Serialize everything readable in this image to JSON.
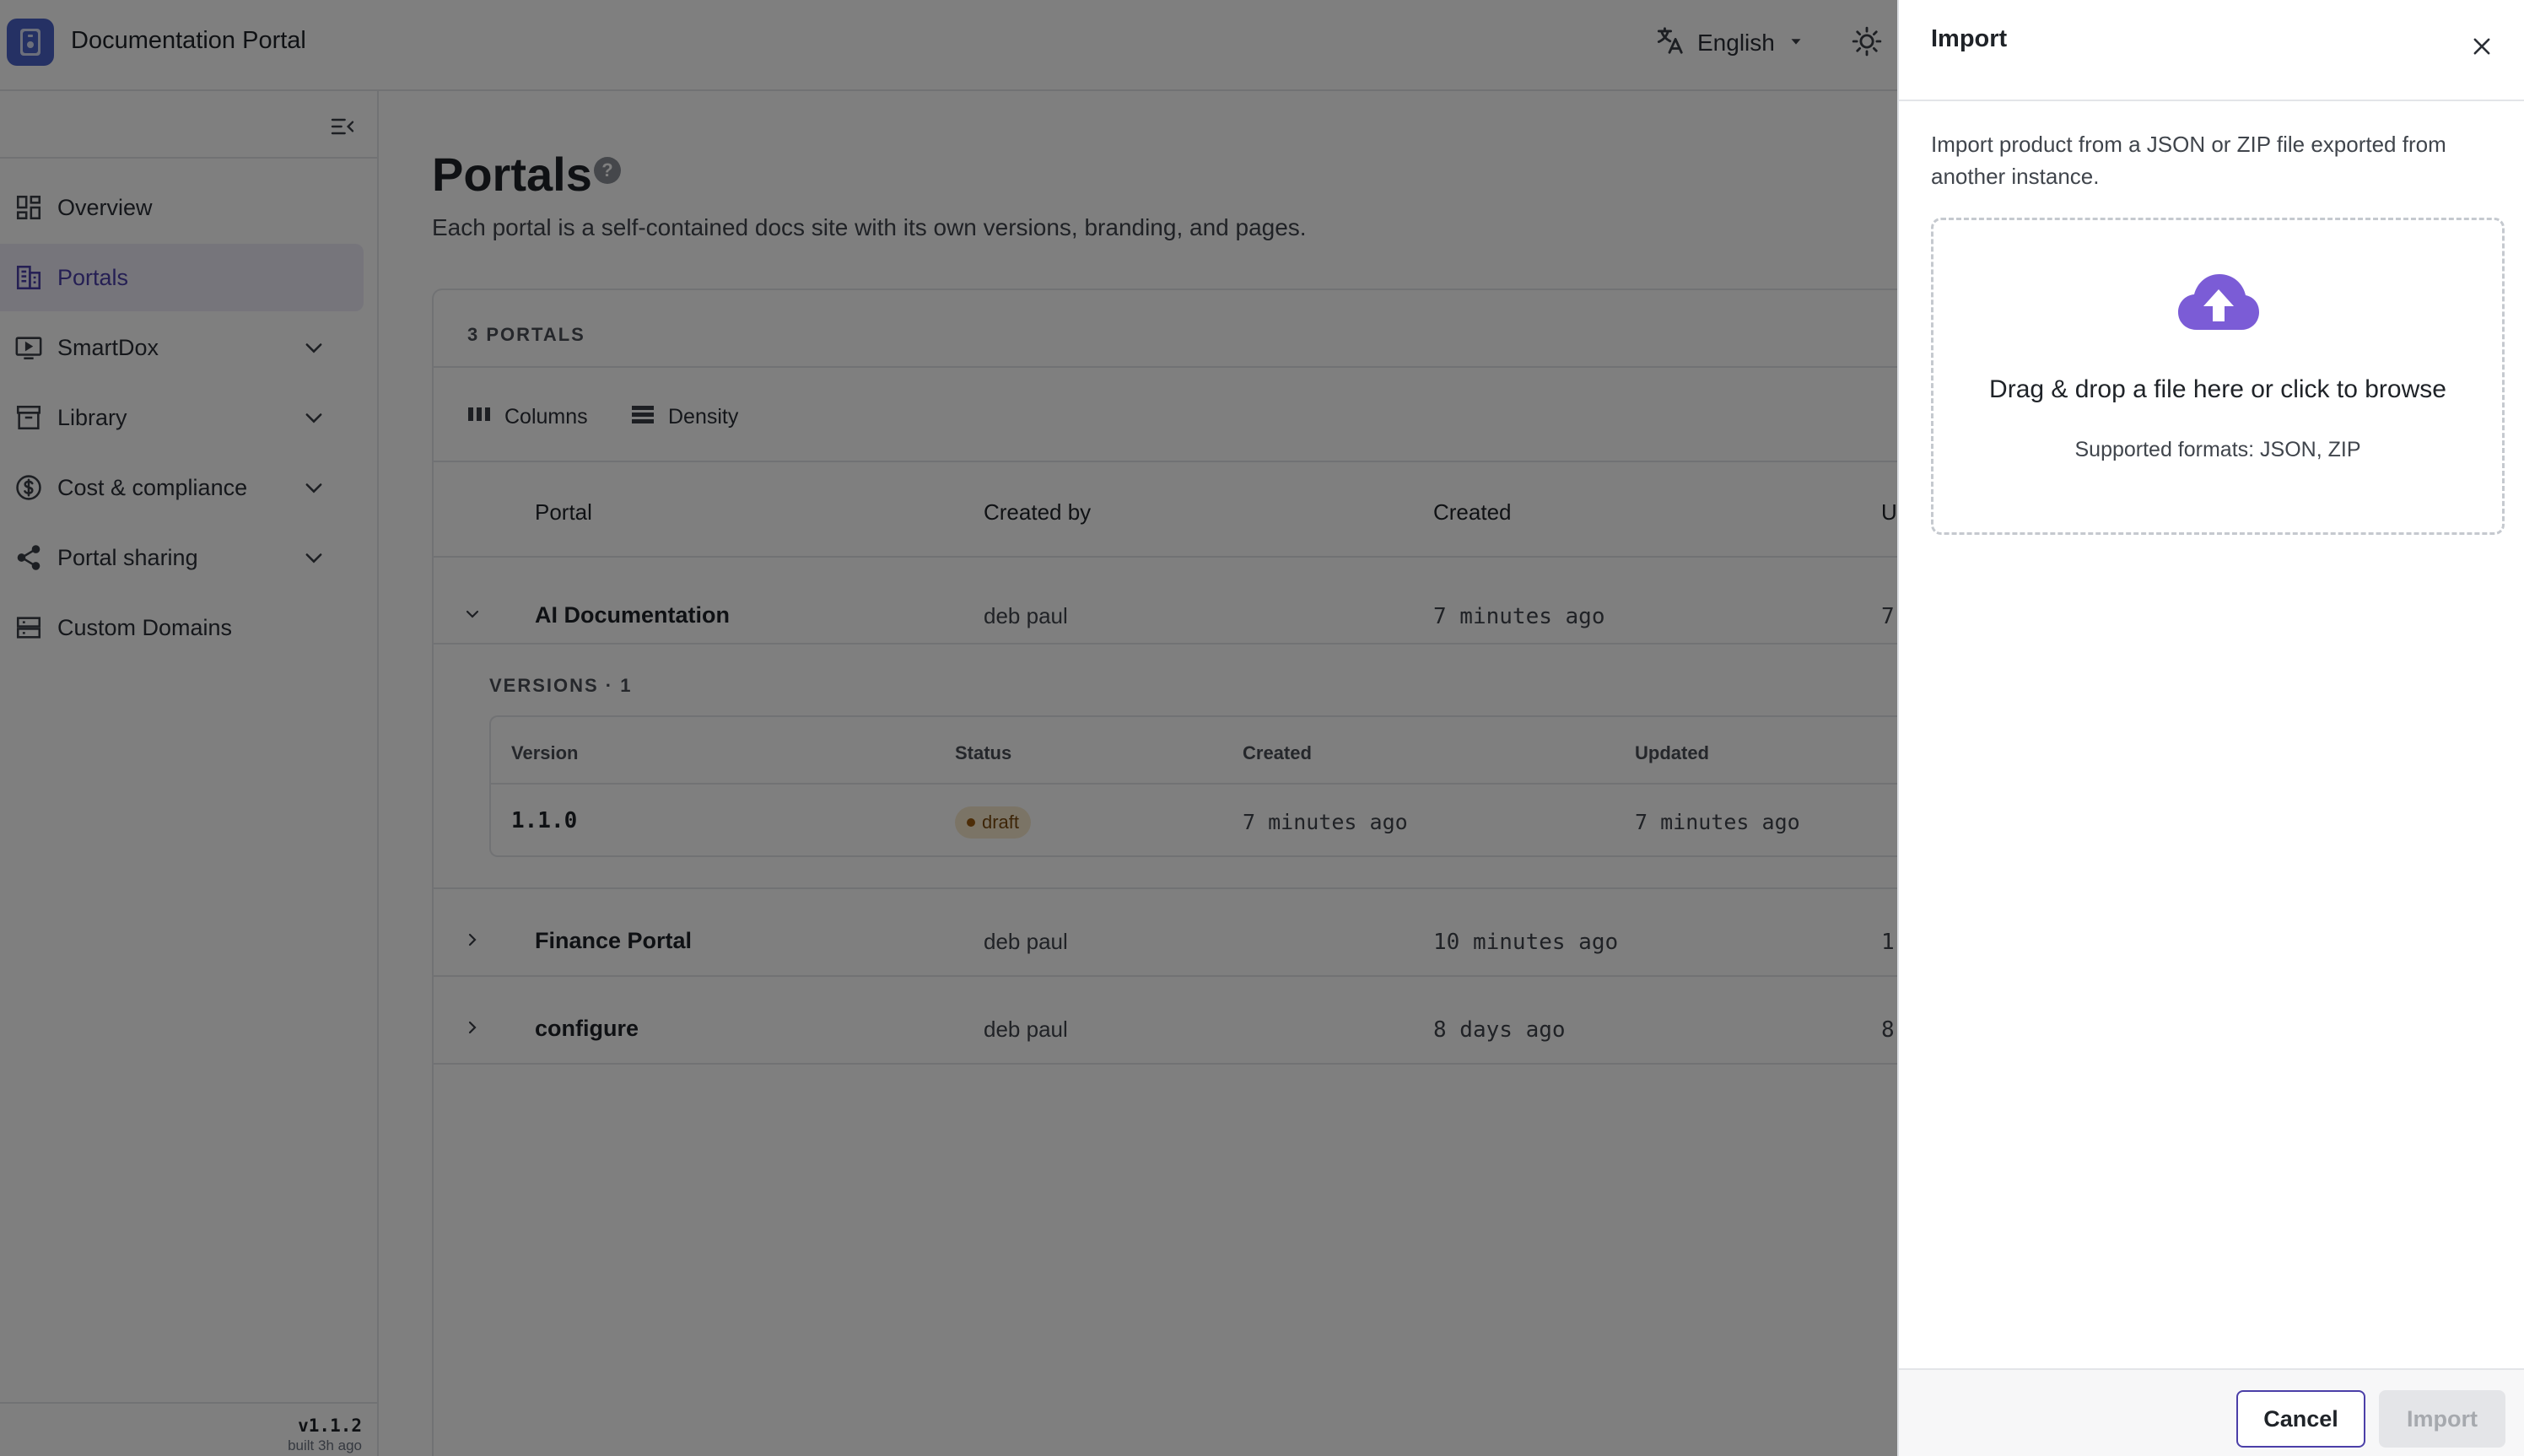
{
  "header": {
    "app_title": "Documentation Portal",
    "language": "English"
  },
  "sidebar": {
    "items": [
      {
        "label": "Overview",
        "icon": "dashboard-icon",
        "active": false,
        "expandable": false
      },
      {
        "label": "Portals",
        "icon": "building-icon",
        "active": true,
        "expandable": false
      },
      {
        "label": "SmartDox",
        "icon": "presentation-icon",
        "active": false,
        "expandable": true
      },
      {
        "label": "Library",
        "icon": "archive-icon",
        "active": false,
        "expandable": true
      },
      {
        "label": "Cost & compliance",
        "icon": "dollar-circle-icon",
        "active": false,
        "expandable": true
      },
      {
        "label": "Portal sharing",
        "icon": "share-icon",
        "active": false,
        "expandable": true
      },
      {
        "label": "Custom Domains",
        "icon": "server-icon",
        "active": false,
        "expandable": false
      }
    ],
    "version": "v1.1.2",
    "build": "built 3h ago"
  },
  "main": {
    "title": "Portals",
    "subtitle": "Each portal is a self-contained docs site with its own versions, branding, and pages.",
    "count_label": "3 PORTALS",
    "toolbar": {
      "columns": "Columns",
      "density": "Density"
    },
    "columns": [
      "Portal",
      "Created by",
      "Created",
      "U"
    ],
    "rows": [
      {
        "name": "AI Documentation",
        "created_by": "deb paul",
        "created": "7 minutes ago",
        "updated_partial": "7",
        "expanded": true
      },
      {
        "name": "Finance Portal",
        "created_by": "deb paul",
        "created": "10 minutes ago",
        "updated_partial": "1",
        "expanded": false
      },
      {
        "name": "configure",
        "created_by": "deb paul",
        "created": "8 days ago",
        "updated_partial": "8",
        "expanded": false
      }
    ],
    "versions": {
      "label": "VERSIONS · 1",
      "columns": [
        "Version",
        "Status",
        "Created",
        "Updated"
      ],
      "rows": [
        {
          "version": "1.1.0",
          "status": "draft",
          "created": "7 minutes ago",
          "updated": "7 minutes ago"
        }
      ]
    }
  },
  "drawer": {
    "title": "Import",
    "description": "Import product from a JSON or ZIP file exported from another instance.",
    "dropzone_title": "Drag & drop a file here or click to browse",
    "dropzone_formats": "Supported formats: JSON, ZIP",
    "cancel_label": "Cancel",
    "import_label": "Import"
  },
  "colors": {
    "accent": "#4b3fa8",
    "upload_icon": "#7b5cd6",
    "logo": "#4a62c8",
    "draft_badge_bg": "#f6e9cc",
    "overlay": "rgba(0,0,0,0.5)"
  }
}
